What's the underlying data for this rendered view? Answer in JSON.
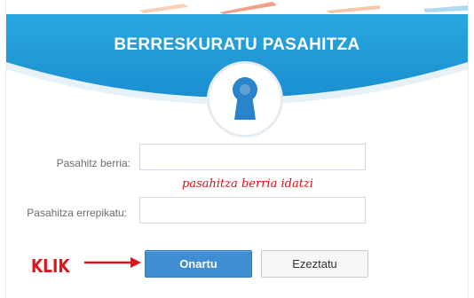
{
  "header": {
    "title": "BERRESKURATU PASAHITZA",
    "accent_color": "#1f9fd8",
    "icon": "keyhole-icon"
  },
  "form": {
    "new_password": {
      "label": "Pasahitz berria:",
      "value": "",
      "hint": "pasahitza berria idatzi"
    },
    "repeat_password": {
      "label": "Pasahitza errepikatu:",
      "value": ""
    }
  },
  "annotation": {
    "text": "KLIK",
    "color": "#e0151c",
    "icon": "arrow-right-icon"
  },
  "actions": {
    "submit_label": "Onartu",
    "cancel_label": "Ezeztatu"
  }
}
